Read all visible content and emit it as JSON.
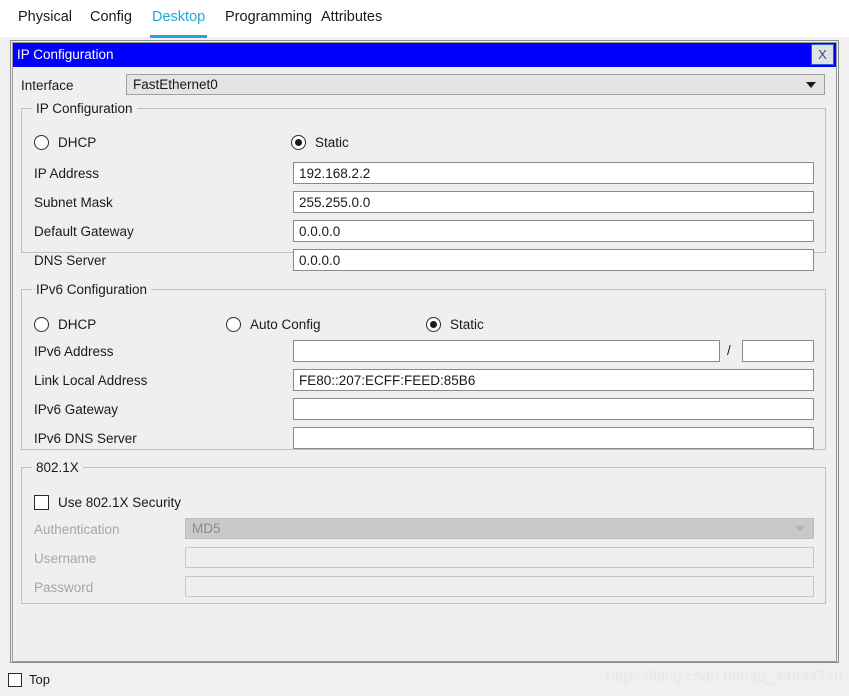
{
  "tabs": [
    {
      "label": "Physical",
      "active": false
    },
    {
      "label": "Config",
      "active": false
    },
    {
      "label": "Desktop",
      "active": true
    },
    {
      "label": "Programming",
      "active": false
    },
    {
      "label": "Attributes",
      "active": false
    }
  ],
  "window": {
    "title": "IP Configuration",
    "close_label": "X",
    "title_bg": "#0000ff",
    "accent": "#1fa8da"
  },
  "interface": {
    "label": "Interface",
    "value": "FastEthernet0",
    "options": [
      "FastEthernet0"
    ]
  },
  "ipv4": {
    "group_title": "IP Configuration",
    "dhcp_label": "DHCP",
    "dhcp_checked": false,
    "static_label": "Static",
    "static_checked": true,
    "fields": [
      {
        "label": "IP Address",
        "value": "192.168.2.2",
        "placeholder": ""
      },
      {
        "label": "Subnet Mask",
        "value": "255.255.0.0",
        "placeholder": ""
      },
      {
        "label": "Default Gateway",
        "value": "0.0.0.0",
        "placeholder": ""
      },
      {
        "label": "DNS Server",
        "value": "0.0.0.0",
        "placeholder": ""
      }
    ]
  },
  "ipv6": {
    "group_title": "IPv6 Configuration",
    "dhcp_label": "DHCP",
    "dhcp_checked": false,
    "auto_label": "Auto Config",
    "auto_checked": false,
    "static_label": "Static",
    "static_checked": true,
    "address_label": "IPv6 Address",
    "address_value": "",
    "prefix_separator": "/",
    "prefix_value": "",
    "fields": [
      {
        "label": "Link Local Address",
        "value": "FE80::207:ECFF:FEED:85B6"
      },
      {
        "label": "IPv6 Gateway",
        "value": ""
      },
      {
        "label": "IPv6 DNS Server",
        "value": ""
      }
    ]
  },
  "dot1x": {
    "group_title": "802.1X",
    "use_label": "Use 802.1X Security",
    "use_checked": false,
    "auth_label": "Authentication",
    "auth_value": "MD5",
    "auth_options": [
      "MD5"
    ],
    "username_label": "Username",
    "username_value": "",
    "password_label": "Password",
    "password_value": ""
  },
  "footer": {
    "top_label": "Top",
    "top_checked": false,
    "watermark": "https://blog.csdn.net/qq_44644740"
  }
}
